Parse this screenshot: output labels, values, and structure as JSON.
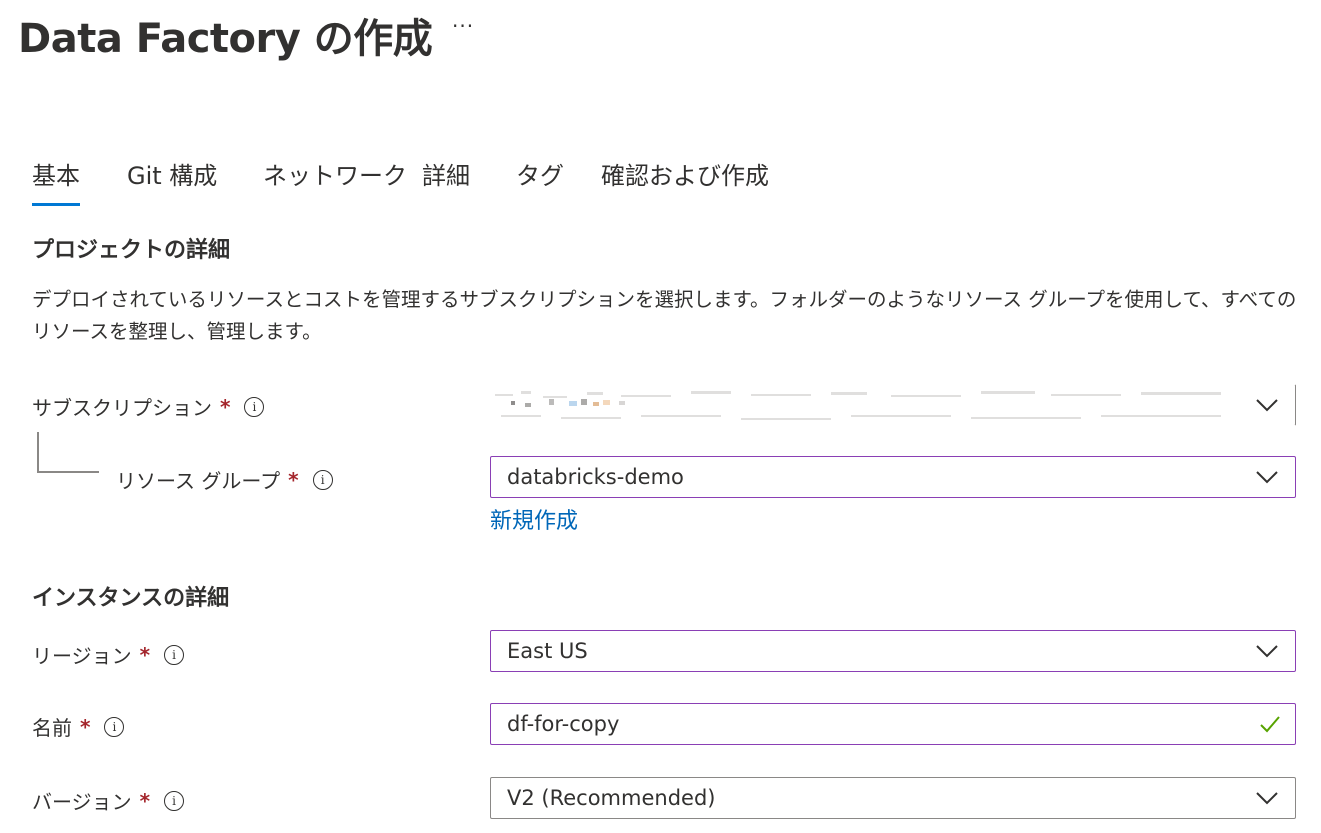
{
  "page": {
    "title": "Data Factory の作成",
    "more_label": "···"
  },
  "tabs": [
    {
      "label": "基本",
      "active": true
    },
    {
      "label": "Git 構成",
      "active": false
    },
    {
      "label": "ネットワーク",
      "active": false
    },
    {
      "label": "詳細",
      "active": false
    },
    {
      "label": "タグ",
      "active": false
    },
    {
      "label": "確認および作成",
      "active": false
    }
  ],
  "project": {
    "heading": "プロジェクトの詳細",
    "description": "デプロイされているリソースとコストを管理するサブスクリプションを選択します。フォルダーのようなリソース グループを使用して、すべてのリソースを整理し、管理します。",
    "subscription": {
      "label": "サブスクリプション",
      "required": "*",
      "info": "i",
      "value": ""
    },
    "resource_group": {
      "label": "リソース グループ",
      "required": "*",
      "info": "i",
      "value": "databricks-demo",
      "create_new_link": "新規作成"
    }
  },
  "instance": {
    "heading": "インスタンスの詳細",
    "region": {
      "label": "リージョン",
      "required": "*",
      "info": "i",
      "value": "East US"
    },
    "name": {
      "label": "名前",
      "required": "*",
      "info": "i",
      "value": "df-for-copy"
    },
    "version": {
      "label": "バージョン",
      "required": "*",
      "info": "i",
      "value": "V2 (Recommended)"
    }
  },
  "colors": {
    "accent": "#0078d4",
    "focus_border": "#8a3fb5",
    "required": "#a4262c",
    "link": "#0067b8",
    "valid_check": "#57a300"
  },
  "icons": {
    "dropdown": "chevron-down-icon",
    "info": "info-icon",
    "valid": "checkmark-icon",
    "more": "more-icon"
  }
}
